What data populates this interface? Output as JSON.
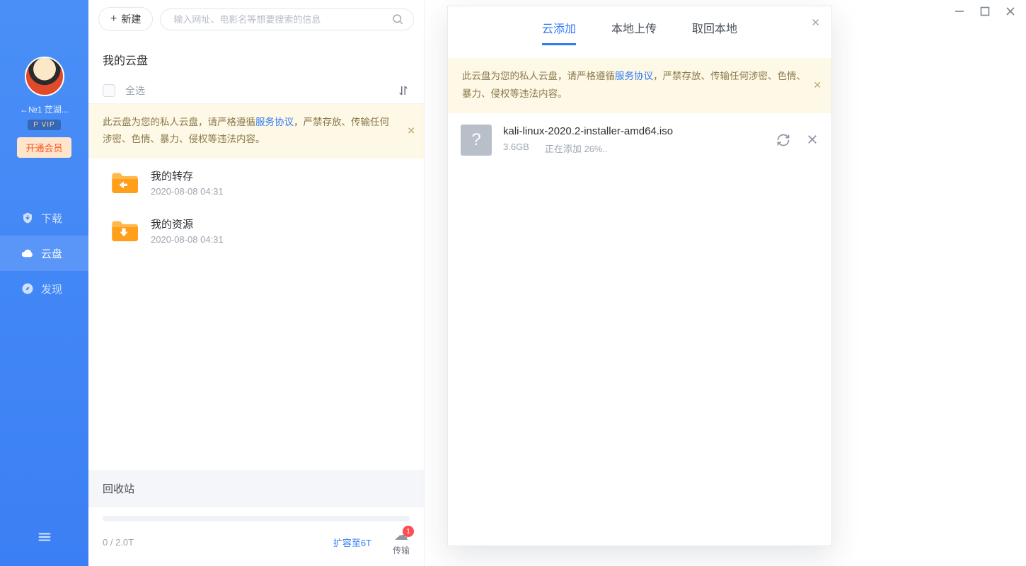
{
  "sidebar": {
    "username": "←№1 茳湖...",
    "vip_badge": "P VIP",
    "open_vip": "开通会员",
    "nav": [
      {
        "icon": "download",
        "label": "下载"
      },
      {
        "icon": "cloud",
        "label": "云盘"
      },
      {
        "icon": "compass",
        "label": "发现"
      }
    ]
  },
  "topbar": {
    "new_btn": "新建",
    "search_placeholder": "输入网址、电影名等想要搜索的信息"
  },
  "main": {
    "title": "我的云盘",
    "select_all": "全选",
    "banner_pre": "此云盘为您的私人云盘，请严格遵循",
    "banner_link": "服务协议",
    "banner_post": "，严禁存放、传输任何涉密、色情、暴力、侵权等违法内容。",
    "files": [
      {
        "name": "我的转存",
        "time": "2020-08-08 04:31",
        "icon": "left"
      },
      {
        "name": "我的资源",
        "time": "2020-08-08 04:31",
        "icon": "down"
      }
    ],
    "recycle": "回收站",
    "storage_used": "0 / 2.0T",
    "expand_link": "扩容至6T",
    "transfer_label": "传输",
    "transfer_badge": "1"
  },
  "dialog": {
    "tabs": [
      "云添加",
      "本地上传",
      "取回本地"
    ],
    "active_tab": 0,
    "banner_pre": "此云盘为您的私人云盘，请严格遵循",
    "banner_link": "服务协议",
    "banner_post": "，严禁存放、传输任何涉密、色情、暴力、侵权等违法内容。",
    "upload": {
      "name": "kali-linux-2020.2-installer-amd64.iso",
      "size": "3.6GB",
      "status": "正在添加 26%.."
    }
  }
}
